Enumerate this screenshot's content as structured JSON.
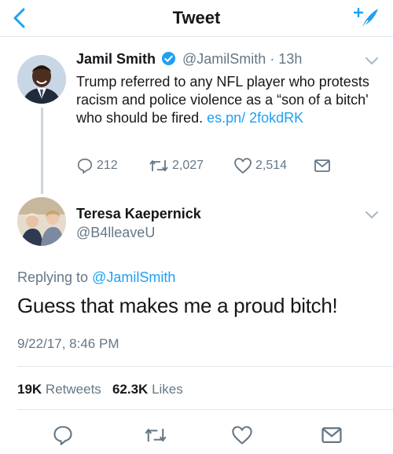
{
  "header": {
    "title": "Tweet"
  },
  "tweet1": {
    "name": "Jamil Smith",
    "handle": "@JamilSmith",
    "time": "· 13h",
    "text_before_link": "Trump referred to any NFL player who protests racism and police violence as a “son of a bitch' who should be fired. ",
    "link": "es.pn/ 2fokdRK",
    "replies": "212",
    "retweets": "2,027",
    "likes": "2,514"
  },
  "tweet2": {
    "name": "Teresa Kaepernick",
    "handle": "@B4lleaveU",
    "replying_prefix": "Replying to ",
    "replying_handle": "@JamilSmith",
    "text": "Guess that makes me a proud bitch!",
    "timestamp": "9/22/17, 8:46 PM",
    "retweets_count": "19K",
    "retweets_label": "Retweets",
    "likes_count": "62.3K",
    "likes_label": "Likes"
  },
  "colors": {
    "accent": "#1da1f2",
    "muted": "#657786",
    "text": "#14171a",
    "divider": "#e1e8ed"
  }
}
